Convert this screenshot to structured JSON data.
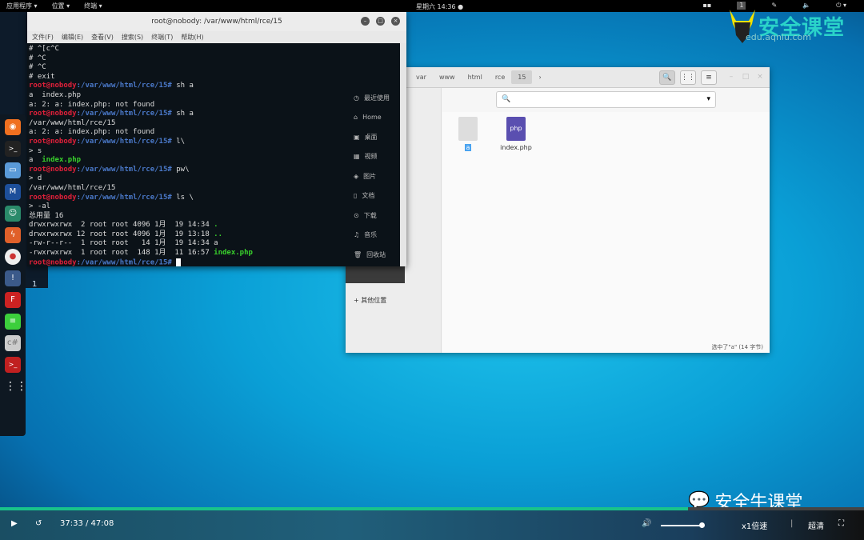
{
  "topbar": {
    "apps": "应用程序 ▾",
    "places": "位置 ▾",
    "terminal": "终端 ▾",
    "clock": "星期六 14:36 ●",
    "workspace": "1"
  },
  "terminal": {
    "title": "root@nobody: /var/www/html/rce/15",
    "menu": [
      "文件(F)",
      "编辑(E)",
      "查看(V)",
      "搜索(S)",
      "终端(T)",
      "帮助(H)"
    ],
    "user": "root@nobody",
    "path": ":/var/www/html/rce/15#",
    "lines": [
      {
        "t": "# ^[c^C"
      },
      {
        "t": "# ^C"
      },
      {
        "t": "# ^C"
      },
      {
        "t": "# exit"
      },
      {
        "cmd": " sh a"
      },
      {
        "t": "a  index.php"
      },
      {
        "t": "a: 2: a: index.php: not found"
      },
      {
        "cmd": " sh a"
      },
      {
        "t": "/var/www/html/rce/15"
      },
      {
        "t": "a: 2: a: index.php: not found"
      },
      {
        "cmd": " l\\"
      },
      {
        "t": "> s"
      },
      {
        "t": "a  ",
        "g": "index.php"
      },
      {
        "cmd": " pw\\"
      },
      {
        "t": "> d"
      },
      {
        "t": "/var/www/html/rce/15"
      },
      {
        "cmd": " ls \\"
      },
      {
        "t": "> -al"
      },
      {
        "t": "总用量 16"
      },
      {
        "t": "drwxrwxrwx  2 root root 4096 1月  19 14:34 ",
        "g": "."
      },
      {
        "t": "drwxrwxrwx 12 root root 4096 1月  19 13:18 ",
        "g": ".."
      },
      {
        "t": "-rw-r--r--  1 root root   14 1月  19 14:34 a"
      },
      {
        "t": "-rwxrwxrwx  1 root root  148 1月  11 16:57 ",
        "g": "index.php"
      },
      {
        "cmd": " ",
        "cursor": true
      }
    ]
  },
  "files": {
    "breadcrumb": [
      "var",
      "www",
      "html",
      "rce",
      "15"
    ],
    "sidebar": [
      "最近使用",
      "Home",
      "桌面",
      "视频",
      "图片",
      "文档",
      "下载",
      "音乐",
      "回收站"
    ],
    "other_locations": "+ 其他位置",
    "items": [
      {
        "name": "a",
        "selected": true
      },
      {
        "name": "index.php",
        "selected": false
      }
    ],
    "status": "选中了\"a\" (14 字节)"
  },
  "background_number": "1",
  "watermark": {
    "brand": "安全课堂",
    "url": "edu.aqniu.com",
    "wechat": "安全牛课堂"
  },
  "player": {
    "current": "37:33",
    "total": "47:08",
    "time": "37:33 / 47:08",
    "speed": "x1倍速",
    "quality": "超清",
    "progress": 0.796,
    "volume": 1.0
  },
  "colors": {
    "accent": "#19c38a",
    "prompt_user": "#e0203a",
    "prompt_path": "#4a78c8",
    "exec_green": "#39d12c"
  }
}
